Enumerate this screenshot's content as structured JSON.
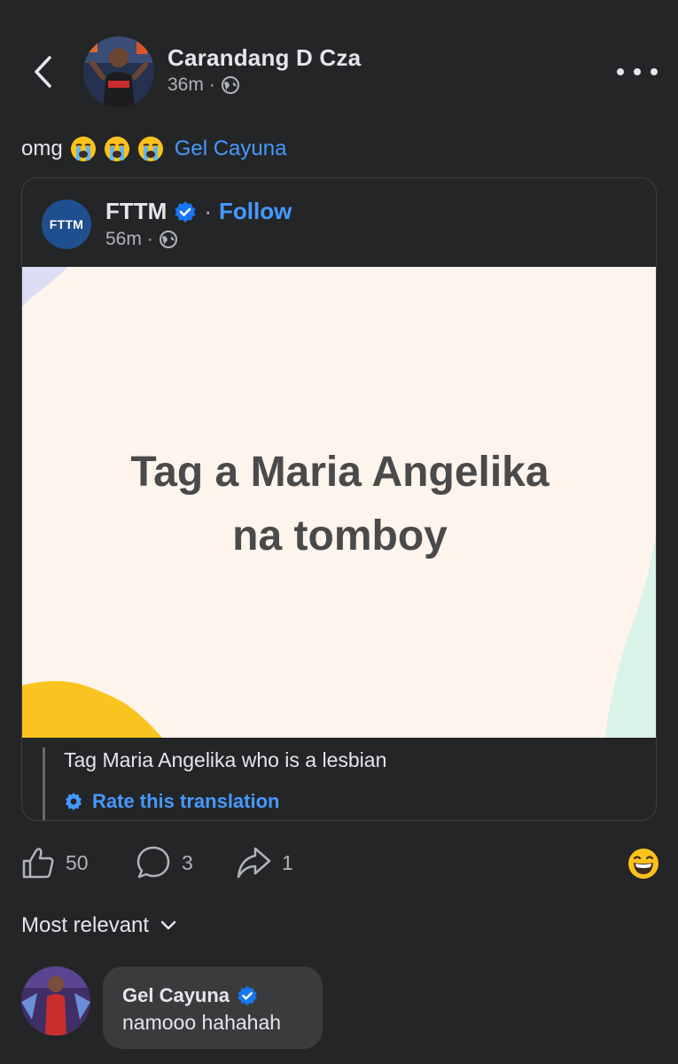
{
  "header": {
    "author_name": "Carandang D Cza",
    "time": "36m",
    "separator": "·"
  },
  "post": {
    "text": "omg",
    "emojis": [
      "loudly-crying-face",
      "loudly-crying-face",
      "loudly-crying-face"
    ],
    "tag": "Gel Cayuna"
  },
  "shared_post": {
    "page_name": "FTTM",
    "logo_text": "FTTM",
    "follow_prefix": "·",
    "follow_label": "Follow",
    "time": "56m",
    "separator": "·",
    "banner_lines": [
      "Tag a Maria Angelika",
      "na tomboy"
    ],
    "banner_bg": "#fdf4ec",
    "translation": "Tag Maria Angelika who is a lesbian",
    "rate_translation": "Rate this translation"
  },
  "actions": {
    "likes": "50",
    "comments": "3",
    "shares": "1"
  },
  "comments_section": {
    "sort_label": "Most relevant",
    "comments": [
      {
        "name": "Gel Cayuna",
        "text": "namooo hahahah",
        "verified": true
      }
    ]
  },
  "colors": {
    "background": "#242526",
    "accent": "#4599ff",
    "verified": "#1877f2",
    "text": "#e4e6eb",
    "muted": "#b0b3b8"
  }
}
